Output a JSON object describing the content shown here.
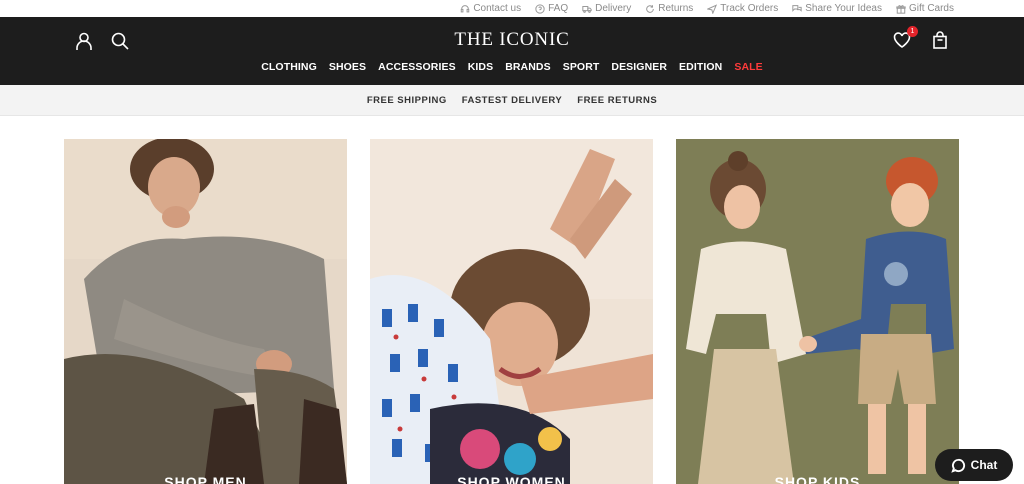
{
  "utility_links": [
    {
      "label": "Contact us",
      "icon": "headset-icon"
    },
    {
      "label": "FAQ",
      "icon": "help-circle-icon"
    },
    {
      "label": "Delivery",
      "icon": "truck-icon"
    },
    {
      "label": "Returns",
      "icon": "refresh-icon"
    },
    {
      "label": "Track Orders",
      "icon": "send-icon"
    },
    {
      "label": "Share Your Ideas",
      "icon": "chat-bubbles-icon"
    },
    {
      "label": "Gift Cards",
      "icon": "gift-icon"
    }
  ],
  "header": {
    "logo": "THE ICONIC",
    "wishlist_count": "1"
  },
  "nav": [
    "CLOTHING",
    "SHOES",
    "ACCESSORIES",
    "KIDS",
    "BRANDS",
    "SPORT",
    "DESIGNER",
    "EDITION",
    "SALE"
  ],
  "promo": [
    "FREE SHIPPING",
    "FASTEST DELIVERY",
    "FREE RETURNS"
  ],
  "tiles": [
    {
      "label": "SHOP MEN"
    },
    {
      "label": "SHOP WOMEN"
    },
    {
      "label": "SHOP KIDS"
    }
  ],
  "chat": {
    "label": "Chat"
  },
  "colors": {
    "header_bg": "#1d1d1d",
    "sale": "#ff3b3b",
    "badge": "#e3242b",
    "promo_bg": "#f3f3f3"
  }
}
